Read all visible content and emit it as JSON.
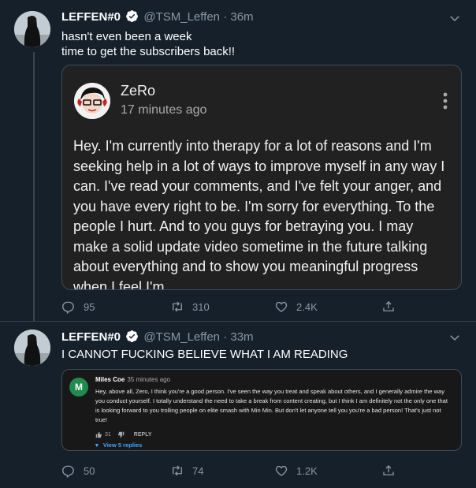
{
  "tweet1": {
    "display_name": "LEFFEN#0",
    "handle": "@TSM_Leffen",
    "separator": "·",
    "time": "36m",
    "text": "hasn't even been a week\ntime to get the subscribers back!!",
    "quoted_comment": {
      "author": "ZeRo",
      "time": "17 minutes ago",
      "body": "Hey. I'm currently into therapy for a lot of reasons and I'm seeking help in a lot of ways to improve myself in any way I can. I've read your comments, and I've felt your anger, and you have every right to be. I'm sorry for everything. To the people I hurt. And to you guys for betraying you. I may make a solid update video sometime in the future talking about everything and to show you meaningful progress when I feel I'm"
    },
    "actions": {
      "replies": "95",
      "retweets": "310",
      "likes": "2.4K"
    }
  },
  "tweet2": {
    "display_name": "LEFFEN#0",
    "handle": "@TSM_Leffen",
    "separator": "·",
    "time": "33m",
    "text": "I CANNOT FUCKING BELIEVE WHAT I AM READING",
    "quoted_comment": {
      "avatar_letter": "M",
      "author": "Miles Coe",
      "time": "35 minutes ago",
      "body": "Hey, above all, Zero, I think you're a good person. I've seen the way you treat and speak about others, and I generally admire the way you conduct yourself. I totally understand the need to take a break from content creating, but I think I am definitely not the only one that is looking forward to you trolling people on elite smash with Min Min. But don't let anyone tell you you're a bad person! That's just not true!",
      "like_count": "31",
      "reply_label": "REPLY",
      "view_replies": "View 5 replies"
    },
    "actions": {
      "replies": "50",
      "retweets": "74",
      "likes": "1.2K"
    }
  },
  "colors": {
    "background": "#15202b",
    "secondary_text": "#8899a6",
    "verified_badge": "#ffffff",
    "link_blue": "#3ea6ff"
  }
}
